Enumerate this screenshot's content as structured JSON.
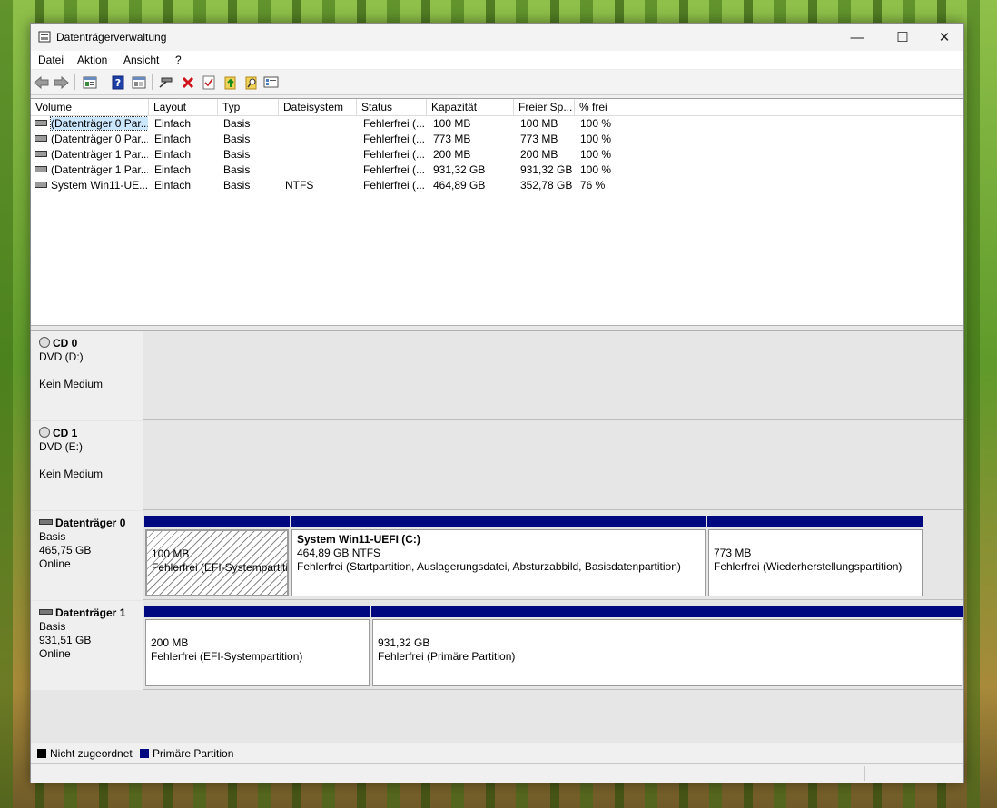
{
  "window": {
    "title": "Datenträgerverwaltung",
    "minimize_glyph": "—",
    "maximize_glyph": "☐",
    "close_glyph": "✕"
  },
  "menu": [
    "Datei",
    "Aktion",
    "Ansicht",
    "?"
  ],
  "toolbar_icons": [
    "back-arrow-icon",
    "forward-arrow-icon",
    "console-tree-icon",
    "help-icon",
    "properties-icon",
    "connect-drive-icon",
    "delete-icon",
    "checkmark-icon",
    "export-folder-icon",
    "search-folder-icon",
    "list-icon"
  ],
  "volume_list": {
    "columns": [
      "Volume",
      "Layout",
      "Typ",
      "Dateisystem",
      "Status",
      "Kapazität",
      "Freier Sp...",
      "% frei"
    ],
    "rows": [
      [
        "(Datenträger 0 Par...",
        "Einfach",
        "Basis",
        "",
        "Fehlerfrei (...",
        "100 MB",
        "100 MB",
        "100 %"
      ],
      [
        "(Datenträger 0 Par...",
        "Einfach",
        "Basis",
        "",
        "Fehlerfrei (...",
        "773 MB",
        "773 MB",
        "100 %"
      ],
      [
        "(Datenträger 1 Par...",
        "Einfach",
        "Basis",
        "",
        "Fehlerfrei (...",
        "200 MB",
        "200 MB",
        "100 %"
      ],
      [
        "(Datenträger 1 Par...",
        "Einfach",
        "Basis",
        "",
        "Fehlerfrei (...",
        "931,32 GB",
        "931,32 GB",
        "100 %"
      ],
      [
        "System Win11-UE...",
        "Einfach",
        "Basis",
        "NTFS",
        "Fehlerfrei (...",
        "464,89 GB",
        "352,78 GB",
        "76 %"
      ]
    ]
  },
  "disks": [
    {
      "name": "CD 0",
      "line1": "DVD (D:)",
      "line2": "",
      "line3": "Kein Medium",
      "kind": "cd",
      "partitions": []
    },
    {
      "name": "CD 1",
      "line1": "DVD (E:)",
      "line2": "",
      "line3": "Kein Medium",
      "kind": "cd",
      "partitions": []
    },
    {
      "name": "Datenträger 0",
      "line1": "Basis",
      "line2": "465,75 GB",
      "line3": "Online",
      "kind": "hd",
      "partitions": [
        {
          "name": "",
          "size": "100 MB",
          "status": "Fehlerfrei (EFI-Systempartition)",
          "selected": true
        },
        {
          "name": "System Win11-UEFI  (C:)",
          "size": "464,89 GB NTFS",
          "status": "Fehlerfrei (Startpartition, Auslagerungsdatei, Absturzabbild, Basisdatenpartition)",
          "selected": false
        },
        {
          "name": "",
          "size": "773 MB",
          "status": "Fehlerfrei (Wiederherstellungspartition)",
          "selected": false
        }
      ]
    },
    {
      "name": "Datenträger 1",
      "line1": "Basis",
      "line2": "931,51 GB",
      "line3": "Online",
      "kind": "hd",
      "partitions": [
        {
          "name": "",
          "size": "200 MB",
          "status": "Fehlerfrei (EFI-Systempartition)",
          "selected": false
        },
        {
          "name": "",
          "size": "931,32 GB",
          "status": "Fehlerfrei (Primäre Partition)",
          "selected": false
        }
      ]
    }
  ],
  "legend": [
    {
      "label": "Nicht zugeordnet",
      "color": "#000000"
    },
    {
      "label": "Primäre Partition",
      "color": "#00087f"
    }
  ],
  "colors": {
    "partition_bar": "#00087f",
    "selection": "#cce8ff"
  }
}
